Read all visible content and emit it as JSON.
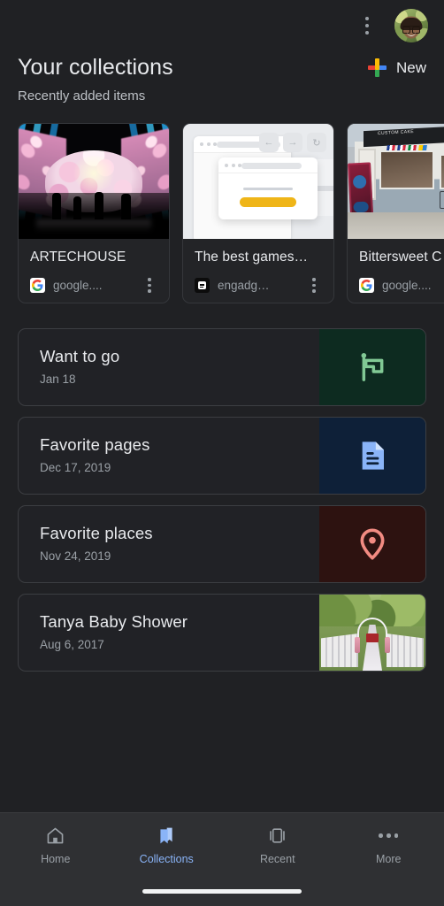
{
  "topbar": {
    "overflow_menu": "more-options",
    "avatar_label": "Account"
  },
  "header": {
    "title": "Your collections",
    "subtitle": "Recently added items",
    "new_label": "New"
  },
  "recent_cards": [
    {
      "title": "ARTECHOUSE",
      "source": "google....",
      "favicon": "google-icon",
      "image": "immersive-art-installation"
    },
    {
      "title": "The best games…",
      "source": "engadg…",
      "favicon": "engadget-icon",
      "image": "browser-windows-illustration"
    },
    {
      "title": "Bittersweet C",
      "source": "google....",
      "favicon": "google-icon",
      "image": "storefront-photo"
    }
  ],
  "collections": [
    {
      "name": "Want to go",
      "date": "Jan 18",
      "icon": "flag-icon",
      "icon_color": "#81c995",
      "tile_color": "#0d2b20"
    },
    {
      "name": "Favorite pages",
      "date": "Dec 17, 2019",
      "icon": "document-icon",
      "icon_color": "#8ab4f8",
      "tile_color": "#0e2038"
    },
    {
      "name": "Favorite places",
      "date": "Nov 24, 2019",
      "icon": "location-pin-icon",
      "icon_color": "#f28b82",
      "tile_color": "#2d1210"
    },
    {
      "name": "Tanya Baby Shower",
      "date": "Aug 6, 2017",
      "icon": "photo-thumbnail",
      "icon_color": "",
      "tile_color": ""
    }
  ],
  "bottom_nav": {
    "items": [
      {
        "label": "Home",
        "icon": "home-icon",
        "active": false
      },
      {
        "label": "Collections",
        "icon": "bookmarks-icon",
        "active": true
      },
      {
        "label": "Recent",
        "icon": "recent-tabs-icon",
        "active": false
      },
      {
        "label": "More",
        "icon": "more-dots-icon",
        "active": false
      }
    ],
    "active_color": "#8ab4f8",
    "inactive_color": "#9aa0a6"
  },
  "theme": {
    "background": "#202124",
    "surface": "#212226",
    "nav_surface": "#2f3033",
    "text_primary": "#e8eaed",
    "text_secondary": "#9aa0a6"
  }
}
